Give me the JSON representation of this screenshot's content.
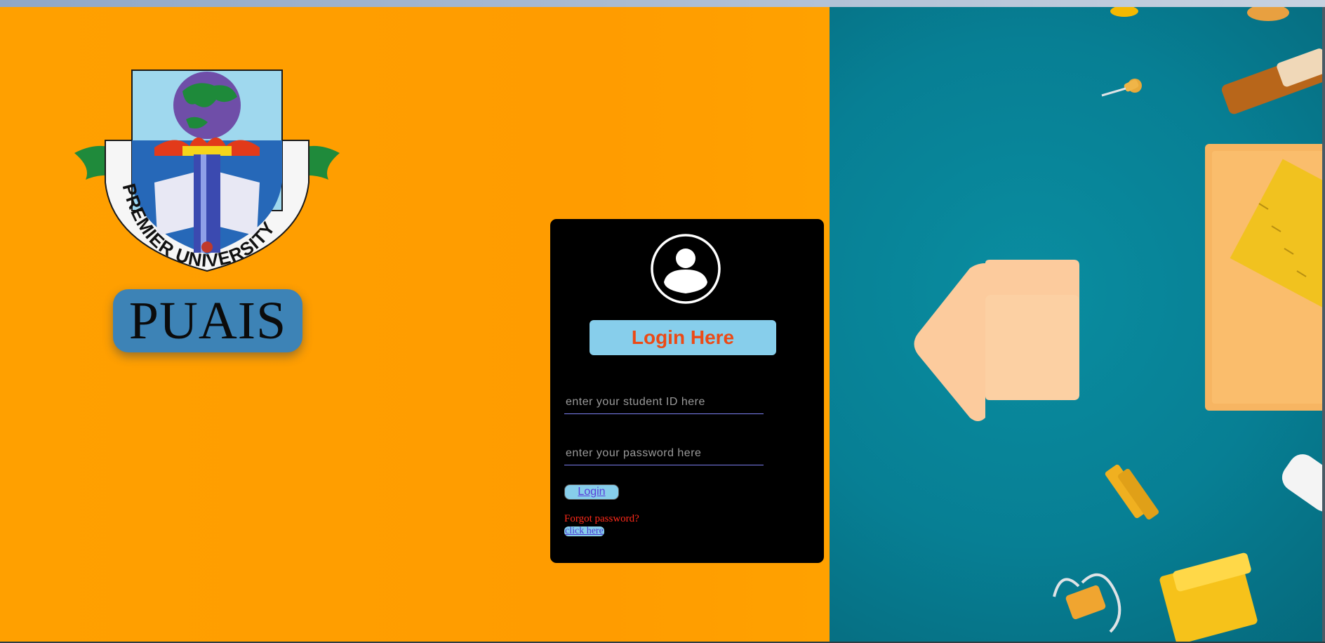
{
  "branding": {
    "logo_ring_text": "PREMIER UNIVERSITY",
    "app_name": "PUAIS"
  },
  "login": {
    "heading": "Login Here",
    "student_id_placeholder": "enter your student ID here",
    "password_placeholder": "enter your password here",
    "submit_label": "Login",
    "forgot_text": "Forgot password?",
    "forgot_link": "click here"
  },
  "colors": {
    "left_background": "#ffa000",
    "right_background": "#077f94",
    "card_background": "#000000",
    "heading_background": "#87ceeb",
    "heading_text": "#ec4a16",
    "forgot_text": "#ff2a1a"
  },
  "icons": {
    "avatar": "user-circle-icon"
  }
}
